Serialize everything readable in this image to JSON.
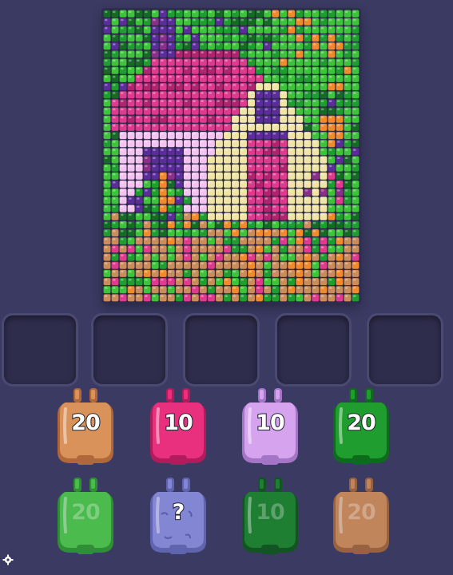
{
  "board": {
    "grid_cols": 32,
    "grid_rows": 36,
    "palette": {
      "a": "#5a2d9a",
      "b": "#3ec43a",
      "c": "#1e9e2e",
      "d": "#146b24",
      "e": "#e03a8e",
      "f": "#b0246e",
      "g": "#f0e5a6",
      "h": "#f3c4f0",
      "i": "#f08a2a",
      "j": "#c98c5a",
      "k": "#8a2f8a"
    }
  },
  "tray": {
    "slot_count": 5
  },
  "jars": [
    {
      "row": 0,
      "col": 0,
      "count": "20",
      "color": "#d9935a",
      "color_dark": "#b0683a",
      "state": "active",
      "label": "20"
    },
    {
      "row": 0,
      "col": 1,
      "count": "10",
      "color": "#e8307f",
      "color_dark": "#b11c5c",
      "state": "active",
      "label": "10"
    },
    {
      "row": 0,
      "col": 2,
      "count": "10",
      "color": "#d6a4ee",
      "color_dark": "#a474c6",
      "state": "active",
      "label": "10"
    },
    {
      "row": 0,
      "col": 3,
      "count": "20",
      "color": "#1f9d2f",
      "color_dark": "#0f6b1c",
      "state": "active",
      "label": "20"
    },
    {
      "row": 1,
      "col": 0,
      "count": "20",
      "color": "#4fd24a",
      "color_dark": "#2f9e2c",
      "state": "locked",
      "label": "20"
    },
    {
      "row": 1,
      "col": 1,
      "count": "?",
      "color": "#8a8fe0",
      "color_dark": "#6469b8",
      "state": "mystery",
      "label": "?"
    },
    {
      "row": 1,
      "col": 2,
      "count": "10",
      "color": "#1a8a2a",
      "color_dark": "#0d5a18",
      "state": "locked",
      "label": "10"
    },
    {
      "row": 1,
      "col": 3,
      "count": "20",
      "color": "#d9935a",
      "color_dark": "#a9683a",
      "state": "locked",
      "label": "20"
    }
  ],
  "icons": {
    "settings": "gear-icon"
  }
}
